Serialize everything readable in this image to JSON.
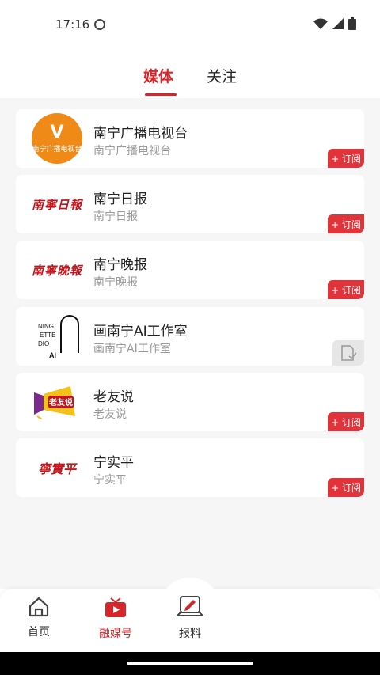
{
  "status_bar": {
    "time": "17:16"
  },
  "tabs": [
    {
      "label": "媒体",
      "active": true
    },
    {
      "label": "关注",
      "active": false
    }
  ],
  "subscribe_label": "+ 订阅",
  "media_list": [
    {
      "name": "南宁广播电视台",
      "subtitle": "南宁广播电视台",
      "logo": {
        "type": "circle",
        "mark": "V",
        "text": "南宁广播电视台"
      },
      "subscribed": false
    },
    {
      "name": "南宁日报",
      "subtitle": "南宁日报",
      "logo": {
        "type": "calligraphy",
        "text": "南寧日報"
      },
      "subscribed": false
    },
    {
      "name": "南宁晚报",
      "subtitle": "南宁晚报",
      "logo": {
        "type": "calligraphy",
        "text": "南寧晚報"
      },
      "subscribed": false
    },
    {
      "name": "画南宁AI工作室",
      "subtitle": "画南宁AI工作室",
      "logo": {
        "type": "ai-studio",
        "lines": [
          "NING",
          "ETTE",
          "DIO",
          "AI"
        ]
      },
      "subscribed": true
    },
    {
      "name": "老友说",
      "subtitle": "老友说",
      "logo": {
        "type": "megaphone",
        "text": "老友说"
      },
      "subscribed": false
    },
    {
      "name": "宁实平",
      "subtitle": "宁实平",
      "logo": {
        "type": "calligraphy",
        "text": "寧實平"
      },
      "subscribed": false
    }
  ],
  "bottom_nav": [
    {
      "label": "首页",
      "icon": "home-icon",
      "active": false
    },
    {
      "label": "融媒号",
      "icon": "tv-icon",
      "active": true
    },
    {
      "label": "报料",
      "icon": "report-edit-icon",
      "active": false
    }
  ],
  "colors": {
    "accent": "#d6262c",
    "subscribe": "#e0333a",
    "tv_logo_bg": "#f08a16"
  }
}
